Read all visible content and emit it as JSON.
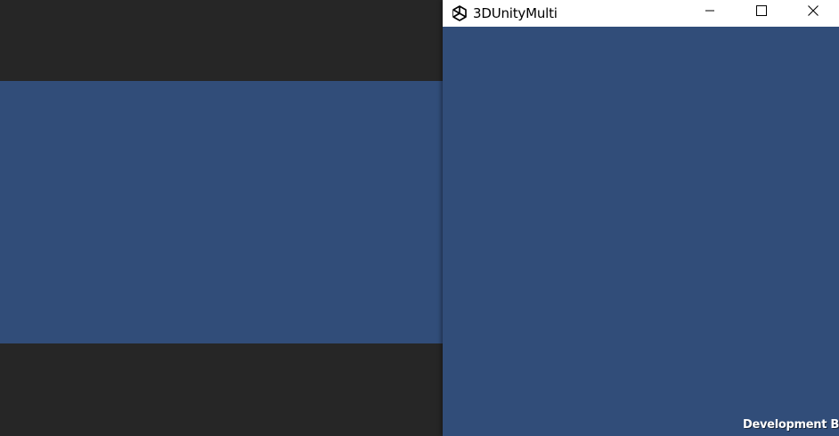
{
  "background_view": {
    "backdrop_color": "#262626",
    "scene_color": "#314d79"
  },
  "window": {
    "title": "3DUnityMulti",
    "icon": "unity-logo-icon",
    "controls": {
      "minimize_icon": "minimize-icon",
      "maximize_icon": "maximize-icon",
      "close_icon": "close-icon"
    },
    "game_area_color": "#314d79"
  },
  "overlay": {
    "development_build_label": "Development Build"
  }
}
